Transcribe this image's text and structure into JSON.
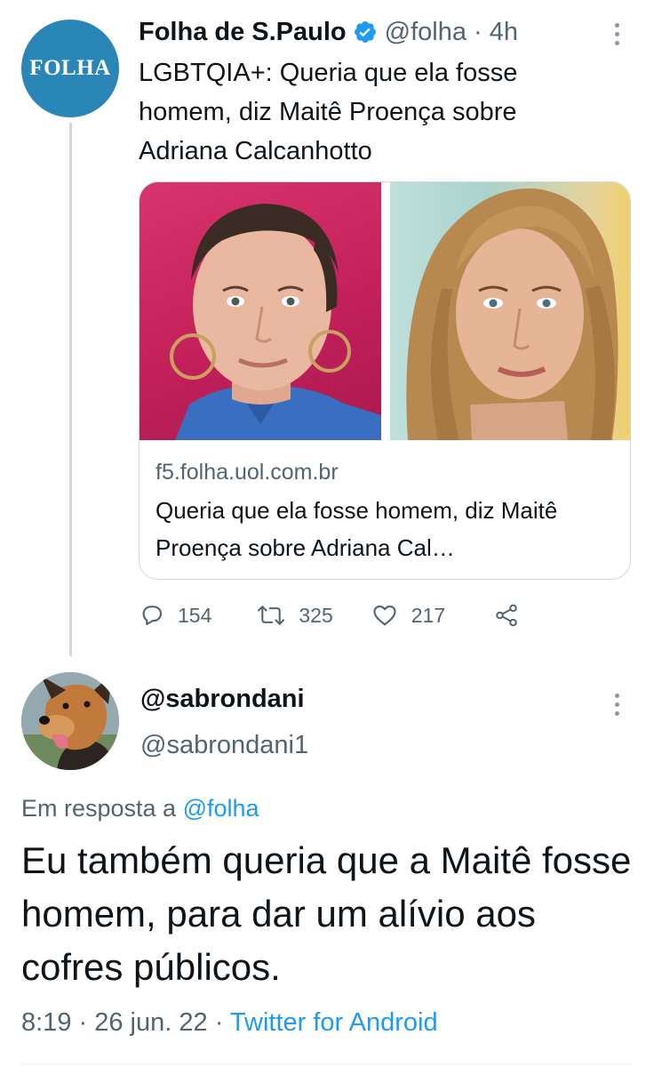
{
  "tweet": {
    "author": {
      "name": "Folha de S.Paulo",
      "handle": "@folha",
      "time": "4h",
      "avatar_text": "FOLHA",
      "verified": true
    },
    "text": "LGBTQIA+: Queria que ela fosse homem, diz Maitê Proença sobre Adriana Calcanhotto",
    "card": {
      "domain": "f5.folha.uol.com.br",
      "title": "Queria que ela fosse homem, diz Maitê Proença sobre Adriana Cal…"
    },
    "actions": {
      "replies": "154",
      "retweets": "325",
      "likes": "217"
    }
  },
  "reply": {
    "display_name": "@sabrondani",
    "handle": "@sabrondani1",
    "in_reply_prefix": "Em resposta a",
    "in_reply_mention": "@folha",
    "text": "Eu também queria que a Maitê fosse homem, para dar um alívio aos cofres públicos.",
    "time": "8:19",
    "date": "26 jun. 22",
    "source": "Twitter for Android"
  },
  "colors": {
    "accent": "#1d9bf0",
    "secondary_text": "#536471",
    "folha_blue": "#2b86b8"
  },
  "icons": [
    "verified-badge-icon",
    "more-icon",
    "reply-icon",
    "retweet-icon",
    "like-icon",
    "share-icon"
  ]
}
